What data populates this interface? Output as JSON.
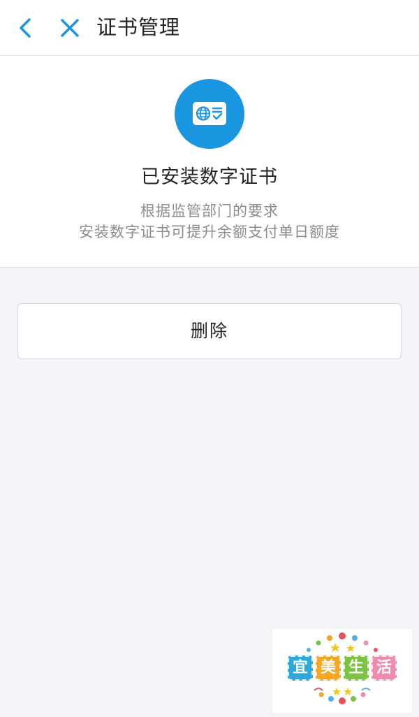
{
  "navbar": {
    "back_icon": "chevron-left-icon",
    "close_icon": "close-icon",
    "title": "证书管理",
    "accent_color": "#1a96e0"
  },
  "hero": {
    "icon": "certificate-globe-check-icon",
    "icon_color": "#1a96e0",
    "title": "已安装数字证书",
    "desc_line1": "根据监管部门的要求",
    "desc_line2": "安装数字证书可提升余额支付单日额度"
  },
  "actions": {
    "delete_label": "删除"
  },
  "watermark": {
    "chars": [
      "宜",
      "美",
      "生",
      "活"
    ],
    "colors": [
      "#2ea8d8",
      "#f5a623",
      "#7cc243",
      "#f08bb0"
    ]
  }
}
